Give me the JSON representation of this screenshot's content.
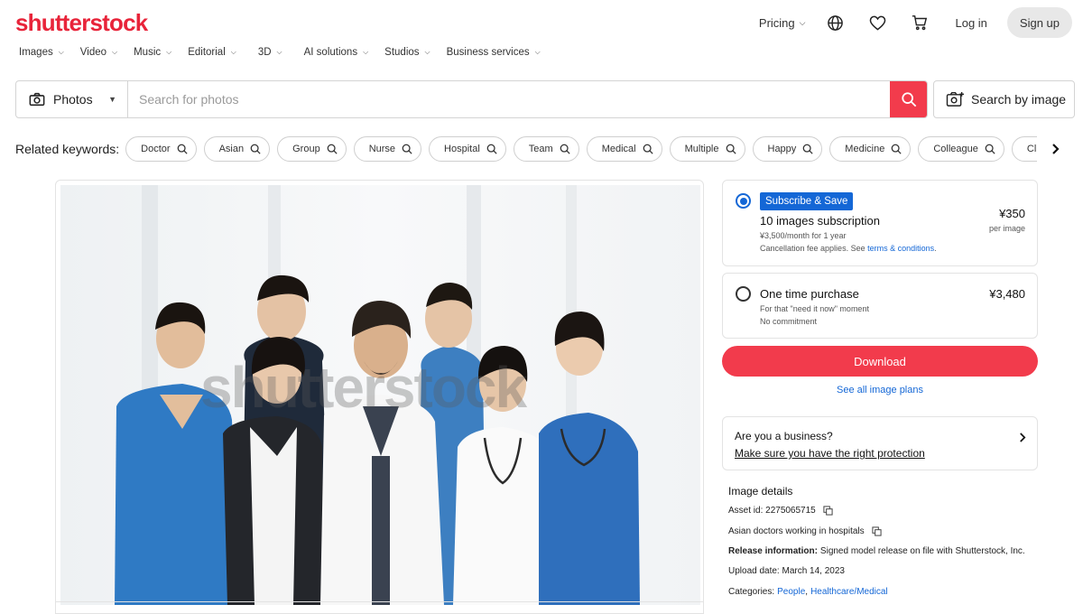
{
  "header": {
    "logo": "shutterstock",
    "pricing_label": "Pricing",
    "login_label": "Log in",
    "signup_label": "Sign up"
  },
  "nav": {
    "items": [
      {
        "label": "Images"
      },
      {
        "label": "Video"
      },
      {
        "label": "Music"
      },
      {
        "label": "Editorial"
      },
      {
        "label": "3D"
      },
      {
        "label": "AI solutions"
      },
      {
        "label": "Studios"
      },
      {
        "label": "Business services"
      }
    ]
  },
  "search": {
    "type_label": "Photos",
    "placeholder": "Search for photos",
    "by_image_label": "Search by image"
  },
  "related": {
    "label": "Related keywords:",
    "keywords": [
      "Doctor",
      "Asian",
      "Group",
      "Nurse",
      "Hospital",
      "Team",
      "Medical",
      "Multiple",
      "Happy",
      "Medicine",
      "Colleague",
      "Clinic"
    ]
  },
  "photo": {
    "watermark": "shutterstock"
  },
  "plans": {
    "subscription": {
      "badge": "Subscribe & Save",
      "title": "10 images subscription",
      "detail": "¥3,500/month for 1 year",
      "cancel_prefix": "Cancellation fee applies. See ",
      "cancel_link": "terms & conditions",
      "cancel_suffix": ".",
      "price": "¥350",
      "price_unit": "per image",
      "selected": true
    },
    "one_time": {
      "title": "One time purchase",
      "price": "¥3,480",
      "line1": "For that \"need it now\" moment",
      "line2": "No commitment",
      "selected": false
    }
  },
  "download_label": "Download",
  "see_plans_label": "See all image plans",
  "business": {
    "title": "Are you a business?",
    "link": "Make sure you have the right protection"
  },
  "details": {
    "heading": "Image details",
    "asset_id": "Asset id: 2275065715",
    "description": "Asian doctors working in hospitals",
    "release_label": "Release information:",
    "release_value": "Signed model release on file with Shutterstock, Inc.",
    "upload_date": "Upload date: March 14, 2023",
    "categories_label": "Categories:",
    "categories": [
      "People",
      "Healthcare/Medical"
    ]
  },
  "colors": {
    "brand_red": "#e8243a",
    "button_red": "#f23b4c",
    "link_blue": "#1467d6"
  },
  "icons": {
    "camera": "camera-icon",
    "search": "search-icon",
    "globe": "globe-icon",
    "heart": "heart-icon",
    "cart": "cart-icon",
    "image_search": "image-search-icon",
    "copy": "copy-icon",
    "chevron": "chevron-right-icon"
  }
}
